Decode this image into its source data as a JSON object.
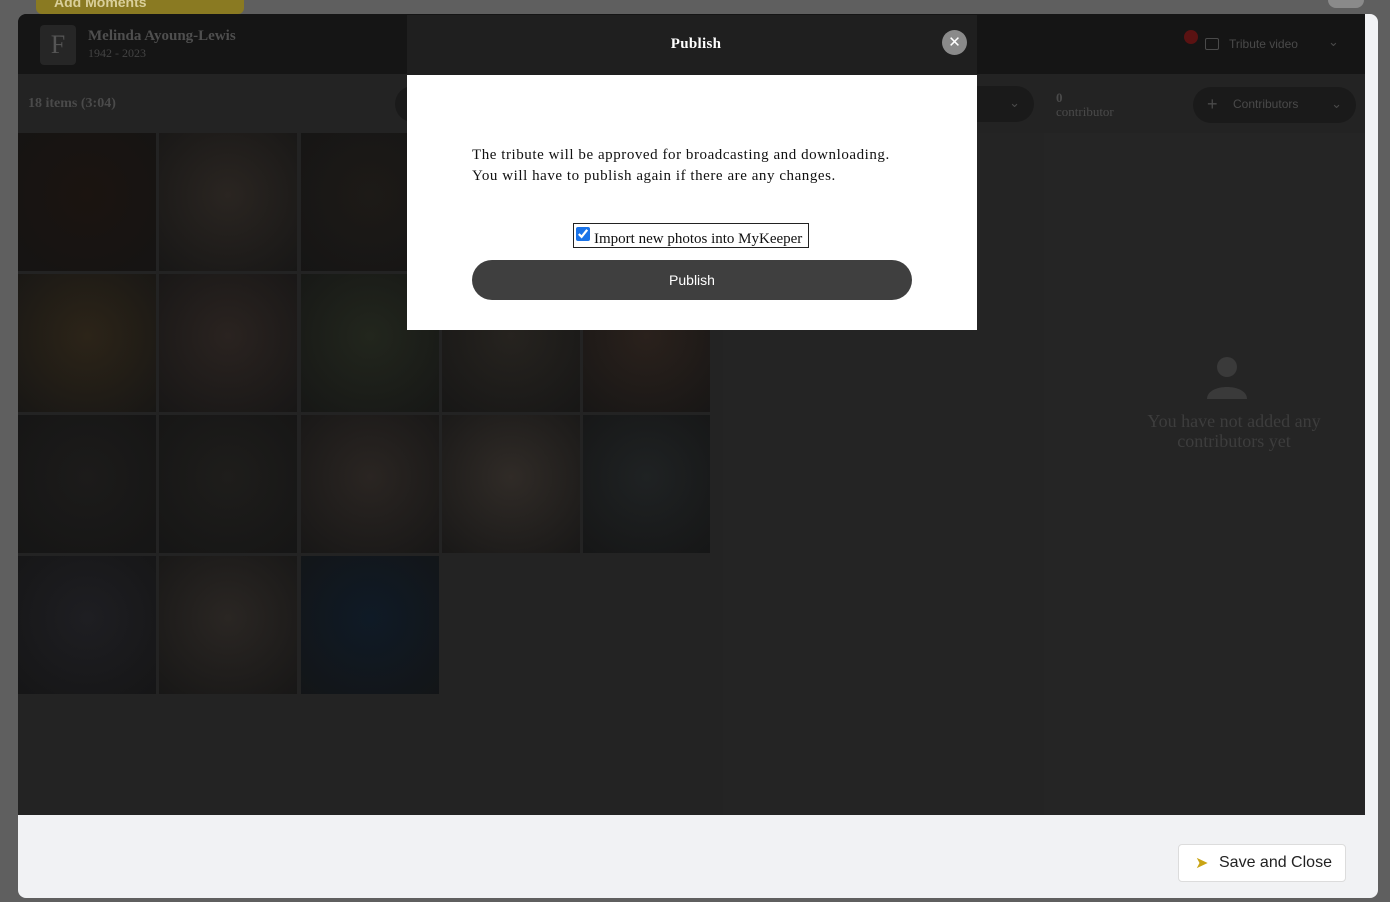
{
  "background": {
    "top_button_label": "Add Moments"
  },
  "header": {
    "logo_letter": "F",
    "name": "Melinda Ayoung-Lewis",
    "years": "1942 - 2023",
    "tribute_label": "Tribute video"
  },
  "toolbar": {
    "items_count": "18 items (3:04)",
    "contributors_count": "0",
    "contributors_word": "contributor",
    "contributors_button": "Contributors"
  },
  "contributors_panel": {
    "empty_message": "You have not added any contributors yet"
  },
  "photos": {
    "tile_colors": [
      [
        "#1b1410",
        "#2a2521",
        "#1d1a17"
      ],
      [
        "#2c2418",
        "#2a2320",
        "#22261d",
        "#26231f",
        "#2a211c"
      ],
      [
        "#1c1b1a",
        "#1e1d1b",
        "#2a2522",
        "#302b27",
        "#1f2223"
      ],
      [
        "#1e1e22",
        "#2a2623",
        "#0f1a26"
      ]
    ]
  },
  "dialog": {
    "title": "Publish",
    "close_glyph": "✕",
    "message_line1": "The tribute will be approved for broadcasting and downloading.",
    "message_line2": "You will have to publish again if there are any changes.",
    "checkbox_label": "Import new photos into MyKeeper",
    "checkbox_checked": true,
    "publish_button": "Publish"
  },
  "footer": {
    "save_close_label": "Save and Close",
    "save_close_icon": "send-arrow-icon"
  },
  "colors": {
    "dialog_header": "#1f1f1f",
    "publish_button": "#3f3f3f",
    "accent_arrow": "#c9a414"
  }
}
